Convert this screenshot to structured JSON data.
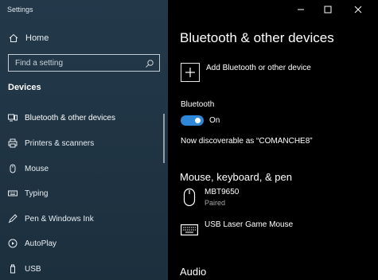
{
  "app": {
    "title": "Settings"
  },
  "sidebar": {
    "home": {
      "label": "Home",
      "icon": "home-icon"
    },
    "search": {
      "placeholder": "Find a setting",
      "icon": "search-icon"
    },
    "section_title": "Devices",
    "items": [
      {
        "label": "Bluetooth & other devices",
        "icon": "bluetooth-devices-icon",
        "active": true
      },
      {
        "label": "Printers & scanners",
        "icon": "printer-icon"
      },
      {
        "label": "Mouse",
        "icon": "mouse-icon"
      },
      {
        "label": "Typing",
        "icon": "keyboard-icon"
      },
      {
        "label": "Pen & Windows Ink",
        "icon": "pen-icon"
      },
      {
        "label": "AutoPlay",
        "icon": "autoplay-icon"
      },
      {
        "label": "USB",
        "icon": "usb-icon"
      }
    ]
  },
  "window_controls": [
    "minimize",
    "maximize",
    "close"
  ],
  "main": {
    "title": "Bluetooth & other devices",
    "add_device_label": "Add Bluetooth or other device",
    "bluetooth": {
      "label": "Bluetooth",
      "state": "On",
      "on": true
    },
    "discoverable": "Now discoverable as “COMANCHE8”",
    "groups": [
      {
        "title": "Mouse, keyboard, & pen",
        "devices": [
          {
            "name": "MBT9650",
            "status": "Paired",
            "icon": "mouse-icon"
          },
          {
            "name": "USB Laser Game Mouse",
            "status": "",
            "icon": "keyboard-icon"
          }
        ]
      },
      {
        "title": "Audio",
        "devices": []
      }
    ]
  },
  "colors": {
    "sidebar_bg": "#1f3342",
    "accent": "#2f87d8",
    "main_bg": "#000000"
  }
}
